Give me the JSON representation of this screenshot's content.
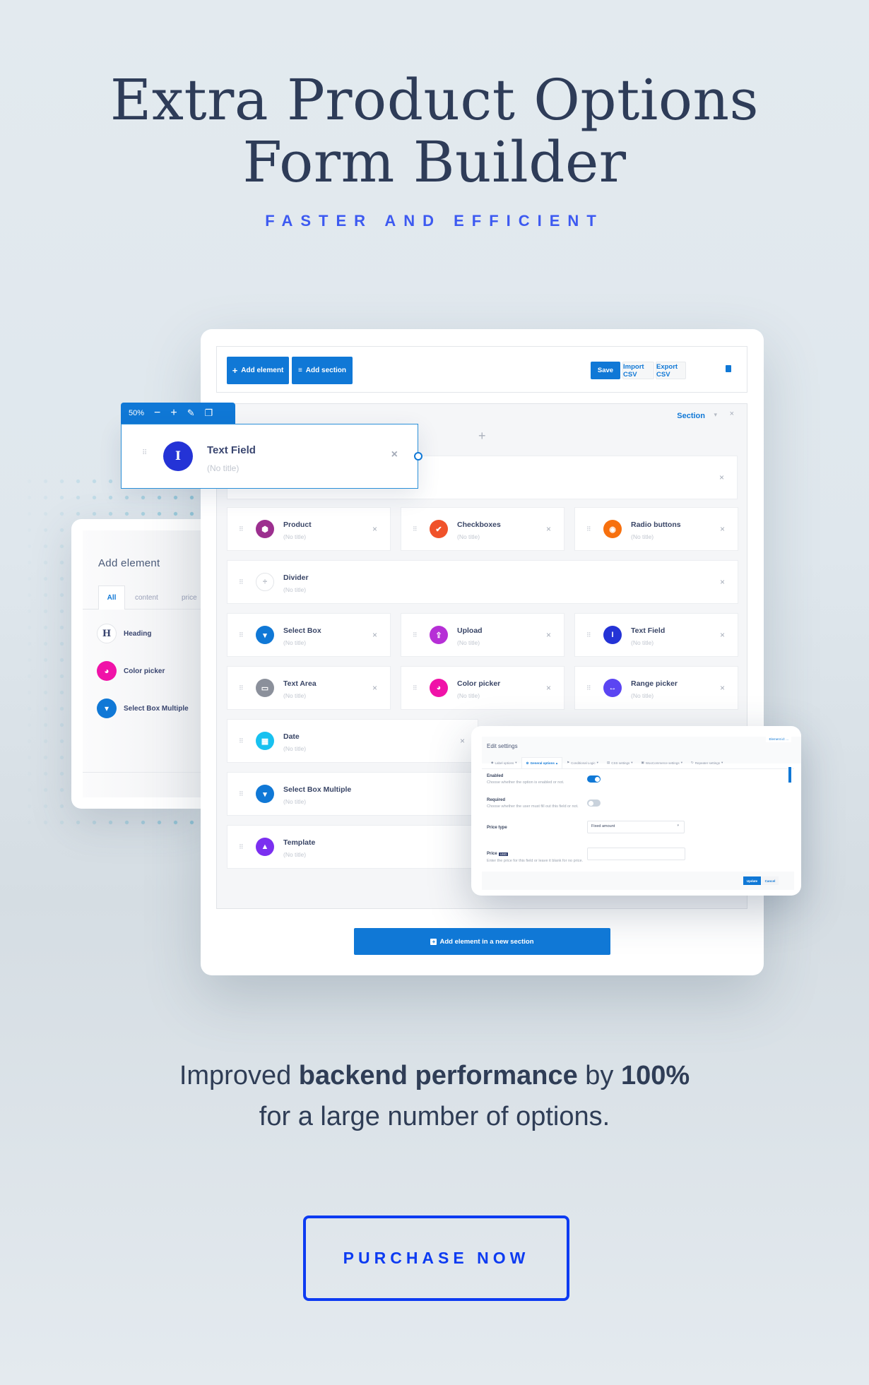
{
  "hero": {
    "title_line1": "Extra Product Options",
    "title_line2": "Form Builder",
    "subtitle": "FASTER AND EFFICIENT"
  },
  "colors": {
    "accent_blue": "#1078d6",
    "hero_subtitle": "#3d5af1",
    "purchase_blue": "#0d3bf2",
    "heading_text": "#2e3c58"
  },
  "toolbar": {
    "add_element": "Add element",
    "add_section": "Add section",
    "save": "Save",
    "import_csv": "Import CSV",
    "export_csv": "Export CSV",
    "add_element_icon": "+",
    "add_section_icon": "≡",
    "collapse_icon": "▬"
  },
  "section": {
    "label": "Section",
    "caret": "▾",
    "close": "×",
    "add_icon": "+"
  },
  "floating_card": {
    "zoom": "50%",
    "zoom_out": "−",
    "zoom_in": "+",
    "edit_icon": "✎",
    "copy_icon": "❐",
    "title": "Text Field",
    "subtitle": "(No title)",
    "icon": "I",
    "icon_color": "#2433d6",
    "close": "×"
  },
  "elements": [
    {
      "title": "Product",
      "subtitle": "(No title)",
      "icon": "⬢",
      "color": "#9c2f8f"
    },
    {
      "title": "Checkboxes",
      "subtitle": "(No title)",
      "icon": "✔",
      "color": "#f0522a"
    },
    {
      "title": "Radio buttons",
      "subtitle": "(No title)",
      "icon": "◉",
      "color": "#f7700e"
    },
    {
      "title": "Divider",
      "subtitle": "(No title)",
      "icon": "÷",
      "color": "#ffffff"
    },
    {
      "title": "Select Box",
      "subtitle": "(No title)",
      "icon": "▾",
      "color": "#1078d6"
    },
    {
      "title": "Upload",
      "subtitle": "(No title)",
      "icon": "⇪",
      "color": "#b62fd6"
    },
    {
      "title": "Text Field",
      "subtitle": "(No title)",
      "icon": "I",
      "color": "#2433d6"
    },
    {
      "title": "Text Area",
      "subtitle": "(No title)",
      "icon": "▭",
      "color": "#8b909b"
    },
    {
      "title": "Color picker",
      "subtitle": "(No title)",
      "icon": "◕",
      "color": "#f012a8"
    },
    {
      "title": "Range picker",
      "subtitle": "(No title)",
      "icon": "↔",
      "color": "#5b45f2"
    },
    {
      "title": "Date",
      "subtitle": "(No title)",
      "icon": "▦",
      "color": "#17c1f0"
    },
    {
      "title": "Select Box Multiple",
      "subtitle": "(No title)",
      "icon": "▾",
      "color": "#1078d6"
    },
    {
      "title": "Template",
      "subtitle": "(No title)",
      "icon": "▲",
      "color": "#7b2ff0"
    }
  ],
  "add_panel": {
    "title": "Add element",
    "tabs": [
      "All",
      "content",
      "price"
    ],
    "items": [
      {
        "label": "Heading",
        "icon": "H",
        "color": "#ffffff"
      },
      {
        "label": "Color picker",
        "icon": "◕",
        "color": "#f012a8"
      },
      {
        "label": "Select Box Multiple",
        "icon": "▾",
        "color": "#1078d6"
      }
    ]
  },
  "edit_settings": {
    "title": "Edit settings",
    "element_id": "Element id: ...",
    "tabs": [
      "Label options",
      "General options",
      "Conditional Logic",
      "CSS settings",
      "WooCommerce settings",
      "Repeater settings"
    ],
    "fields": {
      "enabled_label": "Enabled",
      "enabled_help": "Choose whether the option is enabled or not.",
      "enabled_value": true,
      "required_label": "Required",
      "required_help": "Choose whether the user must fill out this field or not.",
      "required_value": false,
      "price_type_label": "Price type",
      "price_type_value": "Fixed amount",
      "price_label": "Price",
      "price_currency": "USD",
      "price_help": "Enter the price for this field or leave it blank for no price.",
      "price_value": ""
    },
    "update": "Update",
    "cancel": "Cancel"
  },
  "new_section_button": "Add element in a new section",
  "performance": {
    "part1": "Improved ",
    "bold1": "backend performance",
    "part2": " by ",
    "bold2": "100%",
    "line2": "for a large number of options."
  },
  "purchase_button": "PURCHASE NOW"
}
